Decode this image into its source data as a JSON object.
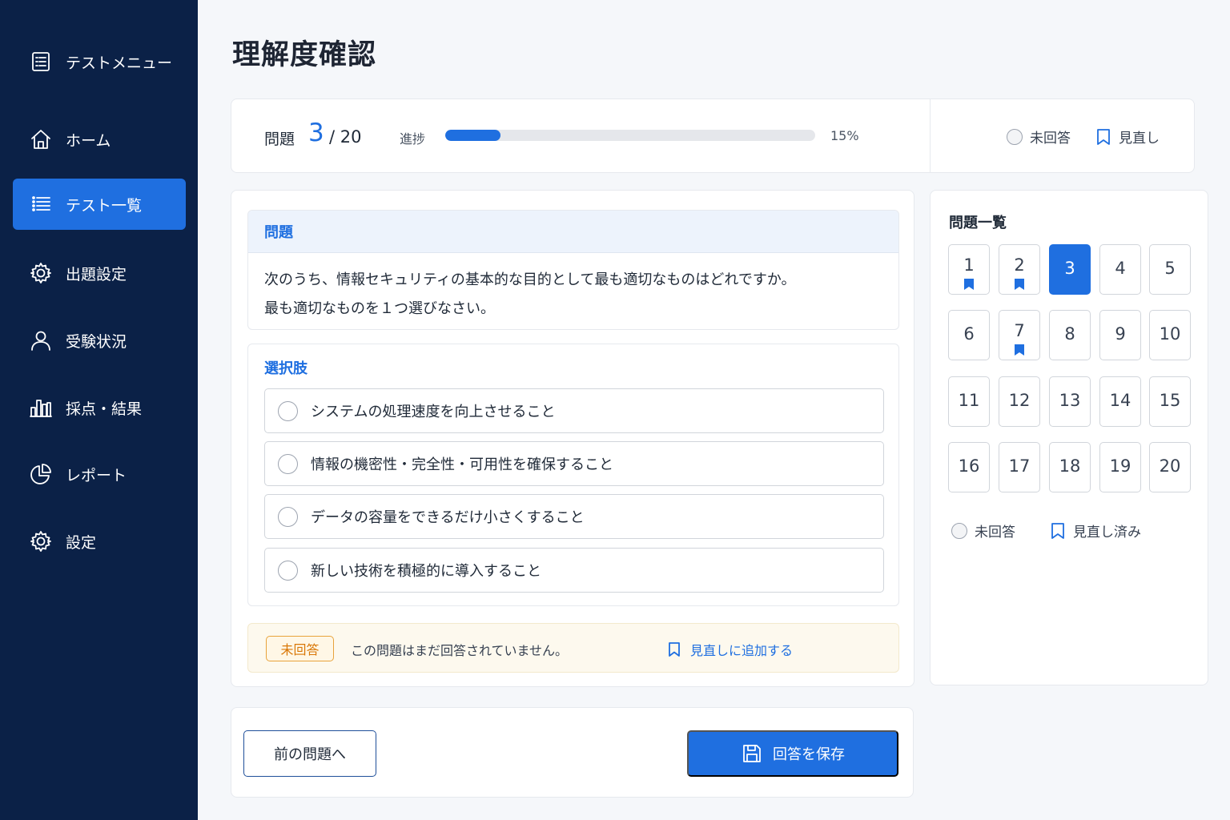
{
  "sidebar": {
    "items": [
      {
        "label": "テストメニュー",
        "icon": "list-document-icon"
      },
      {
        "label": "ホーム",
        "icon": "home-icon"
      },
      {
        "label": "テスト一覧",
        "icon": "list-icon",
        "active": true
      },
      {
        "label": "出題設定",
        "icon": "gear-icon"
      },
      {
        "label": "受験状況",
        "icon": "user-icon"
      },
      {
        "label": "採点・結果",
        "icon": "bar-chart-icon"
      },
      {
        "label": "レポート",
        "icon": "pie-chart-icon"
      },
      {
        "label": "設定",
        "icon": "gear-icon"
      }
    ]
  },
  "page": {
    "title": "理解度確認"
  },
  "progress": {
    "question_label": "問題",
    "current": "3",
    "total": "/ 20",
    "progress_label": "進捗",
    "percent": 15,
    "percent_text": "15%",
    "legend_unanswered": "未回答",
    "legend_review": "見直し"
  },
  "question": {
    "heading": "問題",
    "line1": "次のうち、情報セキュリティの基本的な目的として最も適切なものはどれですか。",
    "line2": "最も適切なものを１つ選びなさい。"
  },
  "options": {
    "heading": "選択肢",
    "items": [
      "システムの処理速度を向上させること",
      "情報の機密性・完全性・可用性を確保すること",
      "データの容量をできるだけ小さくすること",
      "新しい技術を積極的に導入すること"
    ]
  },
  "status": {
    "badge": "未回答",
    "message": "この問題はまだ回答されていません。",
    "add_review": "見直しに追加する"
  },
  "question_list": {
    "title": "問題一覧",
    "numbers": [
      "1",
      "2",
      "3",
      "4",
      "5",
      "6",
      "7",
      "8",
      "9",
      "10",
      "11",
      "12",
      "13",
      "14",
      "15",
      "16",
      "17",
      "18",
      "19",
      "20"
    ],
    "current": "3",
    "review_marked": [
      "1",
      "2",
      "7"
    ],
    "legend_unanswered": "未回答",
    "legend_reviewed": "見直し済み"
  },
  "nav": {
    "prev_label": "前の問題へ",
    "save_label": "回答を保存"
  },
  "colors": {
    "sidebar_bg": "#0b2147",
    "accent": "#1f6fe0",
    "warning": "#d97706"
  }
}
